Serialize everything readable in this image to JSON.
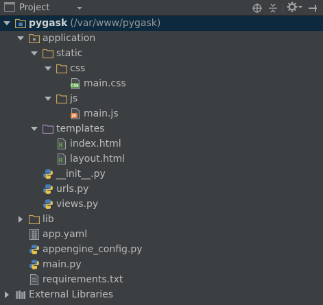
{
  "header": {
    "title": "Project",
    "icons": [
      "project-view-icon",
      "dropdown-arrow-icon",
      "scroll-from-source-icon",
      "collapse-all-icon",
      "gear-icon",
      "hide-panel-icon"
    ]
  },
  "tree": [
    {
      "label": "pygask",
      "path": "(/var/www/pygask)",
      "depth": 0,
      "expanded": true,
      "icon": "folder-module-icon",
      "bold": true,
      "selected": true
    },
    {
      "label": "application",
      "depth": 1,
      "expanded": true,
      "icon": "folder-package-icon"
    },
    {
      "label": "static",
      "depth": 2,
      "expanded": true,
      "icon": "folder-icon"
    },
    {
      "label": "css",
      "depth": 3,
      "expanded": true,
      "icon": "folder-icon"
    },
    {
      "label": "main.css",
      "depth": 4,
      "icon": "css-file-icon"
    },
    {
      "label": "js",
      "depth": 3,
      "expanded": true,
      "icon": "folder-icon"
    },
    {
      "label": "main.js",
      "depth": 4,
      "icon": "js-file-icon"
    },
    {
      "label": "templates",
      "depth": 2,
      "expanded": true,
      "icon": "folder-templates-icon"
    },
    {
      "label": "index.html",
      "depth": 3,
      "icon": "html-file-icon"
    },
    {
      "label": "layout.html",
      "depth": 3,
      "icon": "html-file-icon"
    },
    {
      "label": "__init__.py",
      "depth": 2,
      "icon": "python-file-icon"
    },
    {
      "label": "urls.py",
      "depth": 2,
      "icon": "python-file-icon"
    },
    {
      "label": "views.py",
      "depth": 2,
      "icon": "python-file-icon"
    },
    {
      "label": "lib",
      "depth": 1,
      "expanded": false,
      "icon": "folder-icon"
    },
    {
      "label": "app.yaml",
      "depth": 1,
      "icon": "yaml-file-icon"
    },
    {
      "label": "appengine_config.py",
      "depth": 1,
      "icon": "python-file-icon"
    },
    {
      "label": "main.py",
      "depth": 1,
      "icon": "python-file-icon"
    },
    {
      "label": "requirements.txt",
      "depth": 1,
      "icon": "text-file-icon"
    },
    {
      "label": "External Libraries",
      "depth": 0,
      "expanded": false,
      "icon": "libraries-icon"
    }
  ],
  "colors": {
    "background": "#3c3f41",
    "selection": "#0d293e",
    "text": "#bbbbbb",
    "folder": "#c9a55a",
    "python_blue": "#4a7ab7",
    "python_yellow": "#e6c24a",
    "css_green": "#5fa34b",
    "js_orange": "#e0824a"
  }
}
